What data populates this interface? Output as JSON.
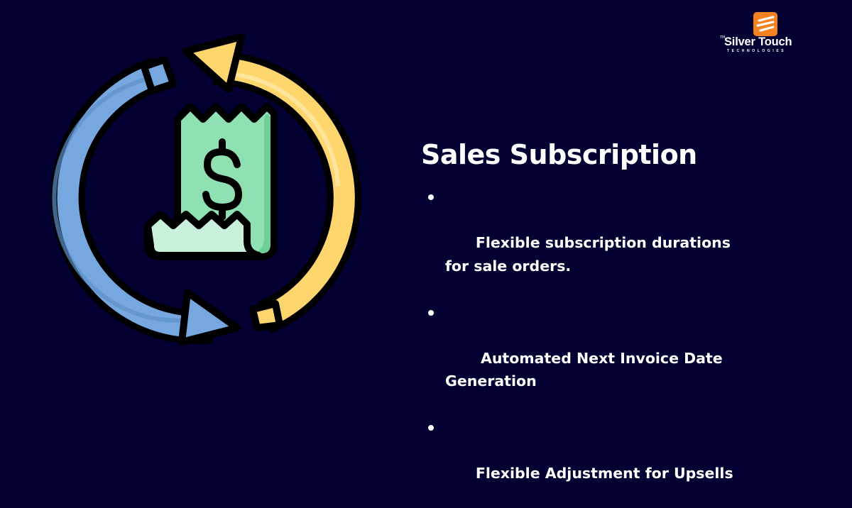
{
  "brand": {
    "tm": "TM",
    "name": "Silver Touch",
    "tagline": "TECHNOLOGIES",
    "accent_color": "#F58220"
  },
  "illustration": {
    "icons": [
      "sync-arrows-icon",
      "receipt-icon",
      "dollar-sign-icon"
    ],
    "colors": {
      "background": "#020131",
      "arrow_blue": "#76A8DF",
      "arrow_yellow": "#FFD66E",
      "receipt": "#8FE0B2",
      "outline": "#000000"
    }
  },
  "content": {
    "title": "Sales Subscription",
    "features": [
      "Flexible subscription durations for sale orders.",
      " Automated Next Invoice Date Generation",
      "Flexible Adjustment for Upsells"
    ]
  }
}
